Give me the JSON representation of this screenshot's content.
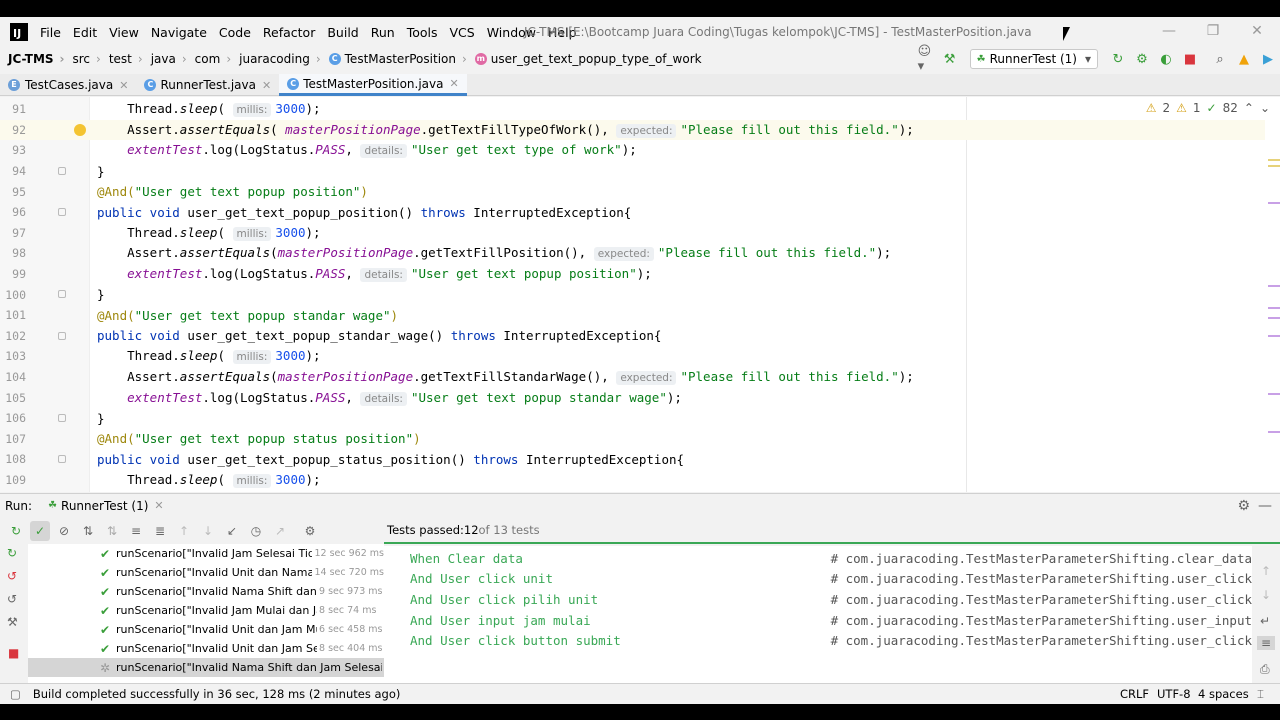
{
  "menubar": {
    "logo": "IJ",
    "items": [
      "File",
      "Edit",
      "View",
      "Navigate",
      "Code",
      "Refactor",
      "Build",
      "Run",
      "Tools",
      "VCS",
      "Window",
      "Help"
    ],
    "window_title": "JC-TMS [E:\\Bootcamp Juara Coding\\Tugas kelompok\\JC-TMS] - TestMasterPosition.java"
  },
  "navbar": {
    "crumbs": [
      "JC-TMS",
      "src",
      "test",
      "java",
      "com",
      "juaracoding",
      "TestMasterPosition",
      "user_get_text_popup_type_of_work"
    ],
    "run_config": "RunnerTest (1)"
  },
  "tabs": [
    "TestCases.java",
    "RunnerTest.java",
    "TestMasterPosition.java"
  ],
  "inspections": {
    "warnings": "2",
    "weak": "1",
    "typos": "82"
  },
  "code": [
    {
      "n": "91",
      "indent": "    ",
      "parts": [
        {
          "t": "Thread.",
          "c": ""
        },
        {
          "t": "sleep",
          "c": "ital"
        },
        {
          "t": "( ",
          "c": ""
        },
        {
          "t": "millis:",
          "c": "hint"
        },
        {
          "t": "3000",
          "c": "num"
        },
        {
          "t": ");",
          "c": ""
        }
      ]
    },
    {
      "n": "92",
      "indent": "    ",
      "cur": true,
      "parts": [
        {
          "t": "Assert.",
          "c": ""
        },
        {
          "t": "assertEquals",
          "c": "ital"
        },
        {
          "t": "( ",
          "c": ""
        },
        {
          "t": "masterPositionPage",
          "c": "field"
        },
        {
          "t": ".getTextFillTypeOfWork(), ",
          "c": ""
        },
        {
          "t": "expected:",
          "c": "hint"
        },
        {
          "t": "\"Please fill out this field.\"",
          "c": "str"
        },
        {
          "t": ");",
          "c": ""
        }
      ]
    },
    {
      "n": "93",
      "indent": "    ",
      "parts": [
        {
          "t": "extentTest",
          "c": "field"
        },
        {
          "t": ".log(LogStatus.",
          "c": ""
        },
        {
          "t": "PASS",
          "c": "field"
        },
        {
          "t": ", ",
          "c": ""
        },
        {
          "t": "details:",
          "c": "hint"
        },
        {
          "t": "\"User get text type of work\"",
          "c": "str"
        },
        {
          "t": ");",
          "c": ""
        }
      ]
    },
    {
      "n": "94",
      "indent": "",
      "parts": [
        {
          "t": "}",
          "c": ""
        }
      ]
    },
    {
      "n": "95",
      "indent": "",
      "parts": [
        {
          "t": "@And(",
          "c": "ann"
        },
        {
          "t": "\"User get text popup position\"",
          "c": "str"
        },
        {
          "t": ")",
          "c": "ann"
        }
      ]
    },
    {
      "n": "96",
      "indent": "",
      "parts": [
        {
          "t": "public void ",
          "c": "kw"
        },
        {
          "t": "user_get_text_popup_position() ",
          "c": ""
        },
        {
          "t": "throws ",
          "c": "kw"
        },
        {
          "t": "InterruptedException{",
          "c": ""
        }
      ]
    },
    {
      "n": "97",
      "indent": "    ",
      "parts": [
        {
          "t": "Thread.",
          "c": ""
        },
        {
          "t": "sleep",
          "c": "ital"
        },
        {
          "t": "( ",
          "c": ""
        },
        {
          "t": "millis:",
          "c": "hint"
        },
        {
          "t": "3000",
          "c": "num"
        },
        {
          "t": ");",
          "c": ""
        }
      ]
    },
    {
      "n": "98",
      "indent": "    ",
      "parts": [
        {
          "t": "Assert.",
          "c": ""
        },
        {
          "t": "assertEquals",
          "c": "ital"
        },
        {
          "t": "(",
          "c": ""
        },
        {
          "t": "masterPositionPage",
          "c": "field"
        },
        {
          "t": ".getTextFillPosition(), ",
          "c": ""
        },
        {
          "t": "expected:",
          "c": "hint"
        },
        {
          "t": "\"Please fill out this field.\"",
          "c": "str"
        },
        {
          "t": ");",
          "c": ""
        }
      ]
    },
    {
      "n": "99",
      "indent": "    ",
      "parts": [
        {
          "t": "extentTest",
          "c": "field"
        },
        {
          "t": ".log(LogStatus.",
          "c": ""
        },
        {
          "t": "PASS",
          "c": "field"
        },
        {
          "t": ", ",
          "c": ""
        },
        {
          "t": "details:",
          "c": "hint"
        },
        {
          "t": "\"User get text popup position\"",
          "c": "str"
        },
        {
          "t": ");",
          "c": ""
        }
      ]
    },
    {
      "n": "100",
      "indent": "",
      "parts": [
        {
          "t": "}",
          "c": ""
        }
      ]
    },
    {
      "n": "101",
      "indent": "",
      "parts": [
        {
          "t": "@And(",
          "c": "ann"
        },
        {
          "t": "\"User get text popup standar wage\"",
          "c": "str"
        },
        {
          "t": ")",
          "c": "ann"
        }
      ]
    },
    {
      "n": "102",
      "indent": "",
      "parts": [
        {
          "t": "public void ",
          "c": "kw"
        },
        {
          "t": "user_get_text_popup_standar_wage() ",
          "c": ""
        },
        {
          "t": "throws ",
          "c": "kw"
        },
        {
          "t": "InterruptedException{",
          "c": ""
        }
      ]
    },
    {
      "n": "103",
      "indent": "    ",
      "parts": [
        {
          "t": "Thread.",
          "c": ""
        },
        {
          "t": "sleep",
          "c": "ital"
        },
        {
          "t": "( ",
          "c": ""
        },
        {
          "t": "millis:",
          "c": "hint"
        },
        {
          "t": "3000",
          "c": "num"
        },
        {
          "t": ");",
          "c": ""
        }
      ]
    },
    {
      "n": "104",
      "indent": "    ",
      "parts": [
        {
          "t": "Assert.",
          "c": ""
        },
        {
          "t": "assertEquals",
          "c": "ital"
        },
        {
          "t": "(",
          "c": ""
        },
        {
          "t": "masterPositionPage",
          "c": "field"
        },
        {
          "t": ".getTextFillStandarWage(), ",
          "c": ""
        },
        {
          "t": "expected:",
          "c": "hint"
        },
        {
          "t": "\"Please fill out this field.\"",
          "c": "str"
        },
        {
          "t": ");",
          "c": ""
        }
      ]
    },
    {
      "n": "105",
      "indent": "    ",
      "parts": [
        {
          "t": "extentTest",
          "c": "field"
        },
        {
          "t": ".log(LogStatus.",
          "c": ""
        },
        {
          "t": "PASS",
          "c": "field"
        },
        {
          "t": ", ",
          "c": ""
        },
        {
          "t": "details:",
          "c": "hint"
        },
        {
          "t": "\"User get text popup standar wage\"",
          "c": "str"
        },
        {
          "t": ");",
          "c": ""
        }
      ]
    },
    {
      "n": "106",
      "indent": "",
      "parts": [
        {
          "t": "}",
          "c": ""
        }
      ]
    },
    {
      "n": "107",
      "indent": "",
      "parts": [
        {
          "t": "@And(",
          "c": "ann"
        },
        {
          "t": "\"User get text popup status position\"",
          "c": "str"
        },
        {
          "t": ")",
          "c": "ann"
        }
      ]
    },
    {
      "n": "108",
      "indent": "",
      "parts": [
        {
          "t": "public void ",
          "c": "kw"
        },
        {
          "t": "user_get_text_popup_status_position() ",
          "c": ""
        },
        {
          "t": "throws ",
          "c": "kw"
        },
        {
          "t": "InterruptedException{",
          "c": ""
        }
      ]
    },
    {
      "n": "109",
      "indent": "    ",
      "parts": [
        {
          "t": "Thread.",
          "c": ""
        },
        {
          "t": "sleep",
          "c": "ital"
        },
        {
          "t": "( ",
          "c": ""
        },
        {
          "t": "millis:",
          "c": "hint"
        },
        {
          "t": "3000",
          "c": "num"
        },
        {
          "t": ");",
          "c": ""
        }
      ]
    }
  ],
  "run": {
    "label": "Run:",
    "tab": "RunnerTest (1)",
    "tests_passed_label": "Tests passed: ",
    "tests_passed_count": "12",
    "tests_total": " of 13 tests"
  },
  "tree": [
    {
      "name": "runScenario[\"Invalid Jam Selesai Tidak D",
      "time": "12 sec 962 ms",
      "state": "pass"
    },
    {
      "name": "runScenario[\"Invalid Unit dan Nama Shi",
      "time": "14 sec 720 ms",
      "state": "pass"
    },
    {
      "name": "runScenario[\"Invalid Nama Shift dan Jam",
      "time": "9 sec 973 ms",
      "state": "pass"
    },
    {
      "name": "runScenario[\"Invalid Jam Mulai dan Jam Se",
      "time": "8 sec 74 ms",
      "state": "pass"
    },
    {
      "name": "runScenario[\"Invalid Unit dan Jam Mulai",
      "time": "6 sec 458 ms",
      "state": "pass"
    },
    {
      "name": "runScenario[\"Invalid Unit dan Jam Selesai",
      "time": "8 sec 404 ms",
      "state": "pass"
    },
    {
      "name": "runScenario[\"Invalid Nama Shift dan Jam Selesai Tidak",
      "time": "",
      "state": "running"
    }
  ],
  "console": [
    {
      "step": "When Clear data",
      "ref": "# com.juaracoding.TestMasterParameterShifting.clear_data"
    },
    {
      "step": "And User click unit",
      "ref": "# com.juaracoding.TestMasterParameterShifting.user_click"
    },
    {
      "step": "And User click pilih unit",
      "ref": "# com.juaracoding.TestMasterParameterShifting.user_click"
    },
    {
      "step": "And User input jam mulai",
      "ref": "# com.juaracoding.TestMasterParameterShifting.user_input"
    },
    {
      "step": "And User click button submit",
      "ref": "# com.juaracoding.TestMasterParameterShifting.user_click"
    }
  ],
  "statusbar": {
    "message": "Build completed successfully in 36 sec, 128 ms (2 minutes ago)",
    "line_sep": "CRLF",
    "encoding": "UTF-8",
    "indent": "4 spaces"
  }
}
